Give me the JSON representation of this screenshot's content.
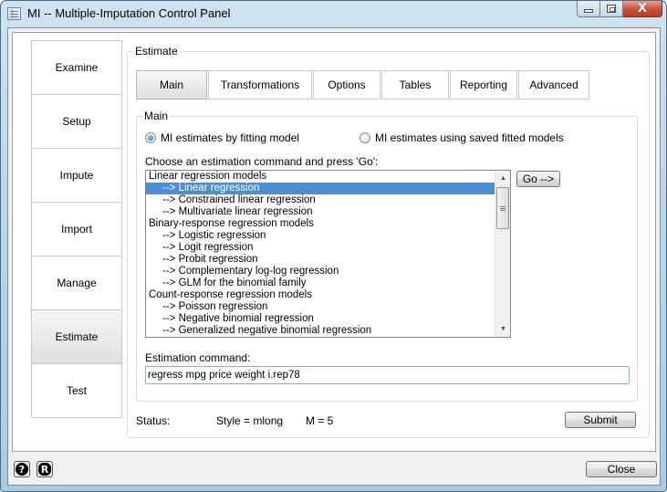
{
  "window": {
    "title": "MI -- Multiple-Imputation Control Panel",
    "icons": {
      "app": "window-app-icon",
      "minimize": "minimize-icon",
      "maximize": "maximize-icon",
      "close": "close-icon"
    },
    "close_glyph": "X"
  },
  "nav": {
    "items": [
      {
        "label": "Examine",
        "active": false
      },
      {
        "label": "Setup",
        "active": false
      },
      {
        "label": "Impute",
        "active": false
      },
      {
        "label": "Import",
        "active": false
      },
      {
        "label": "Manage",
        "active": false
      },
      {
        "label": "Estimate",
        "active": true
      },
      {
        "label": "Test",
        "active": false
      }
    ]
  },
  "estimate": {
    "group_label": "Estimate",
    "tabs": [
      {
        "label": "Main",
        "active": true
      },
      {
        "label": "Transformations",
        "active": false
      },
      {
        "label": "Options",
        "active": false
      },
      {
        "label": "Tables",
        "active": false
      },
      {
        "label": "Reporting",
        "active": false
      },
      {
        "label": "Advanced",
        "active": false
      }
    ],
    "main": {
      "group_label": "Main",
      "radio_fit": {
        "label": "MI estimates by fitting model",
        "checked": true
      },
      "radio_saved": {
        "label": "MI estimates using saved fitted models",
        "checked": false
      },
      "choose_label": "Choose an estimation command and press 'Go':",
      "list_items": [
        {
          "label": "Linear regression models",
          "child": false,
          "selected": false
        },
        {
          "label": "--> Linear regression",
          "child": true,
          "selected": true
        },
        {
          "label": "--> Constrained linear regression",
          "child": true,
          "selected": false
        },
        {
          "label": "--> Multivariate linear regression",
          "child": true,
          "selected": false
        },
        {
          "label": "Binary-response regression models",
          "child": false,
          "selected": false
        },
        {
          "label": "--> Logistic regression",
          "child": true,
          "selected": false
        },
        {
          "label": "--> Logit regression",
          "child": true,
          "selected": false
        },
        {
          "label": "--> Probit regression",
          "child": true,
          "selected": false
        },
        {
          "label": "--> Complementary log-log regression",
          "child": true,
          "selected": false
        },
        {
          "label": "--> GLM for the binomial family",
          "child": true,
          "selected": false
        },
        {
          "label": "Count-response regression models",
          "child": false,
          "selected": false
        },
        {
          "label": "--> Poisson regression",
          "child": true,
          "selected": false
        },
        {
          "label": "--> Negative binomial regression",
          "child": true,
          "selected": false
        },
        {
          "label": "--> Generalized negative binomial regression",
          "child": true,
          "selected": false
        }
      ],
      "scroll_up_glyph": "▲",
      "scroll_down_glyph": "▼",
      "go_label": "Go -->",
      "command_label": "Estimation command:",
      "command_value": "regress mpg price weight i.rep78"
    },
    "status": {
      "label": "Status:",
      "style": "Style = mlong",
      "m": "M = 5"
    },
    "submit_label": "Submit"
  },
  "footer": {
    "help_glyph": "?",
    "about_glyph": "R",
    "close_label": "Close"
  },
  "colors": {
    "selection": "#4e8dd0",
    "close_button": "#c8513a"
  }
}
